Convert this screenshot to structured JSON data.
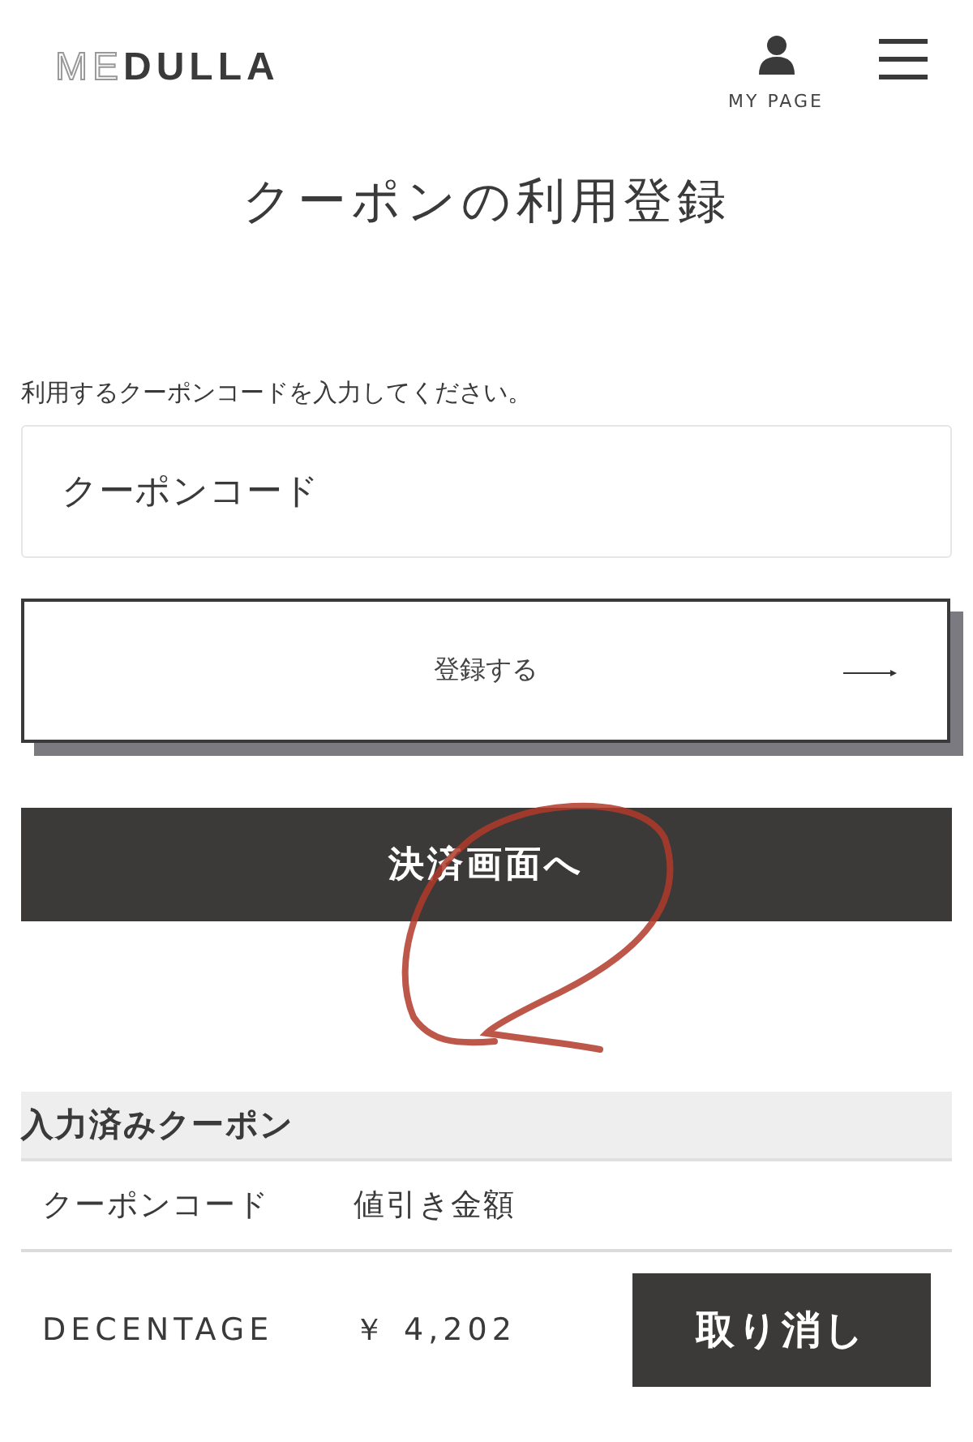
{
  "header": {
    "logo": {
      "outlined_part": "ME",
      "solid_part": "DULLA"
    },
    "my_page_label": "MY PAGE"
  },
  "title": "クーポンの利用登録",
  "coupon_form": {
    "label": "利用するクーポンコードを入力してください。",
    "placeholder": "クーポンコード",
    "register_button": "登録する"
  },
  "checkout_button": "決済画面へ",
  "annotation": {
    "kind": "loop"
  },
  "applied_coupons": {
    "heading": "入力済みクーポン",
    "columns": [
      "クーポンコード",
      "値引き金額"
    ],
    "rows": [
      {
        "code": "DECENTAGE",
        "amount": "￥ 4,202",
        "cancel_button": "取り消し"
      }
    ]
  }
}
